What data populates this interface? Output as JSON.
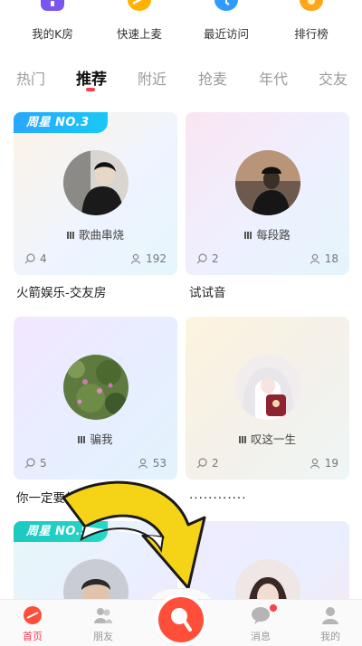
{
  "quick_actions": [
    {
      "label": "我的K房",
      "icon": "my-room-icon",
      "color": "#7a56f0"
    },
    {
      "label": "快速上麦",
      "icon": "quick-mic-icon",
      "color": "#ffb300"
    },
    {
      "label": "最近访问",
      "icon": "recent-visit-icon",
      "color": "#2f9bff"
    },
    {
      "label": "排行榜",
      "icon": "ranking-trophy-icon",
      "color": "#ffa61a"
    }
  ],
  "tabs": [
    {
      "label": "热门",
      "active": false
    },
    {
      "label": "推荐",
      "active": true
    },
    {
      "label": "附近",
      "active": false
    },
    {
      "label": "抢麦",
      "active": false
    },
    {
      "label": "年代",
      "active": false
    },
    {
      "label": "交友",
      "active": false
    }
  ],
  "rooms": [
    {
      "badge": "周星 NO.3",
      "song": "歌曲串烧",
      "comments": "4",
      "listeners": "192",
      "title": "火箭娱乐-交友房"
    },
    {
      "badge": "",
      "song": "每段路",
      "comments": "2",
      "listeners": "18",
      "title": "试试音"
    },
    {
      "badge": "",
      "song": "骗我",
      "comments": "5",
      "listeners": "53",
      "title": "你一定要的..."
    },
    {
      "badge": "",
      "song": "叹这一生",
      "comments": "2",
      "listeners": "19",
      "title": "............"
    },
    {
      "badge": "周星 NO.5",
      "song": "",
      "comments": "",
      "listeners": "",
      "title": ""
    },
    {
      "badge": "",
      "song": "",
      "comments": "",
      "listeners": "",
      "title": ""
    }
  ],
  "bottom_nav": [
    {
      "label": "首页",
      "icon": "home-icon",
      "active": true
    },
    {
      "label": "朋友",
      "icon": "friends-icon",
      "active": false
    },
    {
      "label": "",
      "icon": "sing-mic-icon",
      "active": false
    },
    {
      "label": "消息",
      "icon": "message-icon",
      "active": false
    },
    {
      "label": "我的",
      "icon": "profile-icon",
      "active": false
    }
  ],
  "colors": {
    "accent": "#ff3d4d",
    "badge": "#29a7ff",
    "center_button": "#ff4f3a",
    "annotation_arrow": "#f5d417"
  }
}
